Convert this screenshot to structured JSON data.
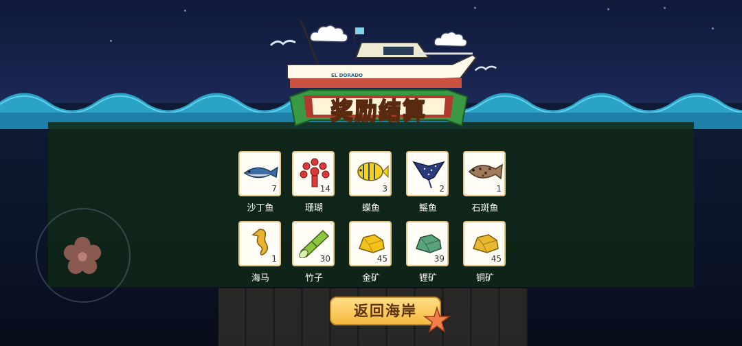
{
  "scene": {
    "title": "奖励结算",
    "boat_name": "EL DORADO"
  },
  "rewards": [
    {
      "name": "沙丁鱼",
      "count": "7",
      "icon": "sardine-icon"
    },
    {
      "name": "珊瑚",
      "count": "14",
      "icon": "coral-icon"
    },
    {
      "name": "蝶鱼",
      "count": "3",
      "icon": "butterflyfish-icon"
    },
    {
      "name": "鳐鱼",
      "count": "2",
      "icon": "stingray-icon"
    },
    {
      "name": "石斑鱼",
      "count": "1",
      "icon": "grouper-icon"
    },
    {
      "name": "海马",
      "count": "1",
      "icon": "seahorse-icon"
    },
    {
      "name": "竹子",
      "count": "30",
      "icon": "bamboo-icon"
    },
    {
      "name": "金矿",
      "count": "45",
      "icon": "gold-ore-icon"
    },
    {
      "name": "锂矿",
      "count": "39",
      "icon": "lithium-ore-icon"
    },
    {
      "name": "铜矿",
      "count": "45",
      "icon": "copper-ore-icon"
    }
  ],
  "actions": {
    "return_label": "返回海岸"
  },
  "colors": {
    "title_yellow": "#ffd43a",
    "button_gold": "#f5b93e",
    "card_border": "#e9c887"
  }
}
